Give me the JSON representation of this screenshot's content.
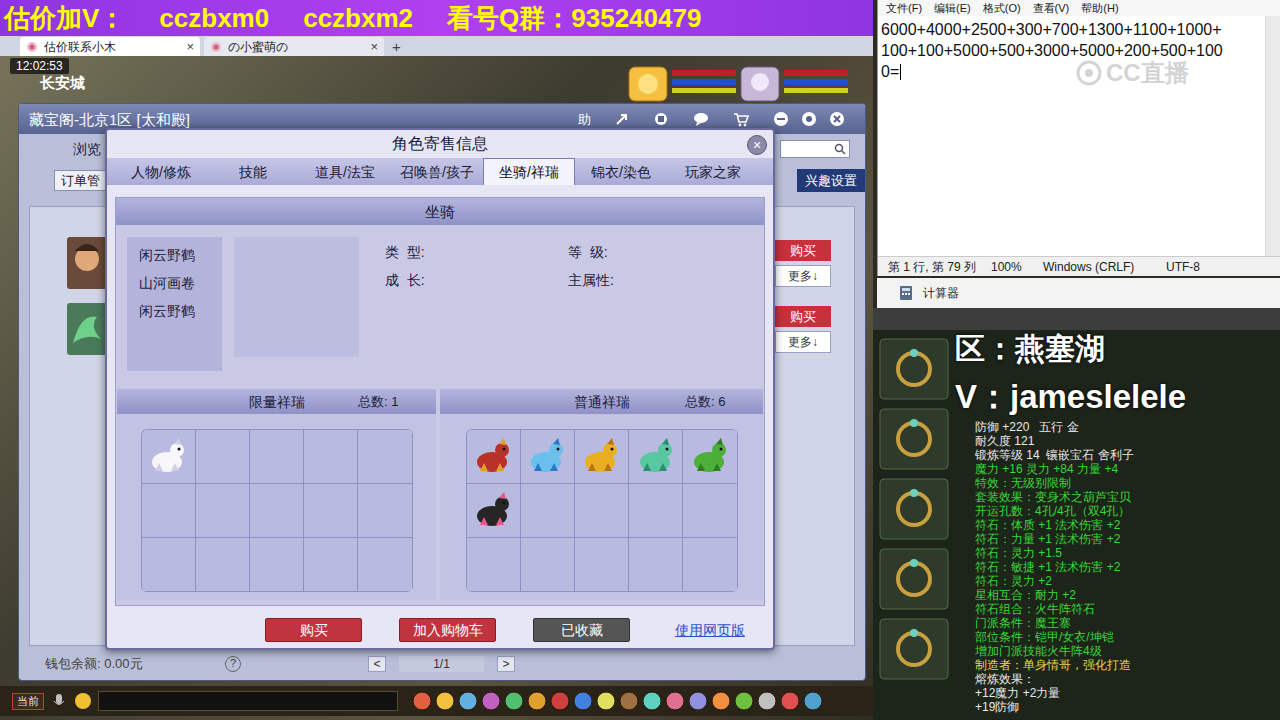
{
  "banner": [
    "估价加V：",
    "cczbxm0",
    "cczbxm2",
    "看号Q群：935240479"
  ],
  "browser": {
    "tabs": [
      {
        "label": "估价联系小木",
        "selected": true,
        "close": "×"
      },
      {
        "label": "の小蜜萌の",
        "selected": false,
        "close": "×"
      }
    ],
    "new_tab": "+"
  },
  "game": {
    "clock": "12:02:53",
    "location": "长安城",
    "chat_channel": "当前"
  },
  "cbg": {
    "title": "藏宝阁-北京1区 [太和殿]",
    "help": "助",
    "nav": "浏览",
    "orders": "订单管",
    "interest": "兴趣设置",
    "listings": [
      {
        "buy": "购买",
        "more": "更多↓"
      },
      {
        "buy": "购买",
        "more": "更多↓"
      }
    ],
    "wallet": "钱包余额: 0.00元",
    "help_mark": "?",
    "pager": {
      "prev": "<",
      "page": "1/1",
      "next": ">"
    }
  },
  "dialog": {
    "title": "角色寄售信息",
    "close": "×",
    "tabs": [
      {
        "label": "人物/修炼",
        "selected": false
      },
      {
        "label": "技能",
        "selected": false
      },
      {
        "label": "道具/法宝",
        "selected": false
      },
      {
        "label": "召唤兽/孩子",
        "selected": false
      },
      {
        "label": "坐骑/祥瑞",
        "selected": true
      },
      {
        "label": "锦衣/染色",
        "selected": false
      },
      {
        "label": "玩家之家",
        "selected": false
      }
    ],
    "section": "坐骑",
    "mounts": [
      {
        "name": "闲云野鹤",
        "selected": false
      },
      {
        "name": "山河画卷",
        "selected": false
      },
      {
        "name": "闲云野鹤",
        "selected": false
      }
    ],
    "fields": [
      "类  型:",
      "等  级:",
      "成  长:",
      "主属性:"
    ],
    "limited": {
      "title": "限量祥瑞",
      "total": "总数: 1",
      "slots": [
        {
          "filled": true
        },
        {
          "filled": false
        },
        {
          "filled": false
        },
        {
          "filled": false
        },
        {
          "filled": false
        },
        {
          "filled": false
        },
        {
          "filled": false
        },
        {
          "filled": false
        },
        {
          "filled": false
        },
        {
          "filled": false
        },
        {
          "filled": false
        },
        {
          "filled": false
        },
        {
          "filled": false
        },
        {
          "filled": false
        },
        {
          "filled": false
        }
      ]
    },
    "normal": {
      "title": "普通祥瑞",
      "total": "总数: 6",
      "slots": [
        {
          "filled": true
        },
        {
          "filled": true
        },
        {
          "filled": true
        },
        {
          "filled": true
        },
        {
          "filled": true
        },
        {
          "filled": true
        },
        {
          "filled": false
        },
        {
          "filled": false
        },
        {
          "filled": false
        },
        {
          "filled": false
        },
        {
          "filled": false
        },
        {
          "filled": false
        },
        {
          "filled": false
        },
        {
          "filled": false
        },
        {
          "filled": false
        }
      ]
    },
    "buttons": [
      {
        "label": "购买",
        "kind": "red"
      },
      {
        "label": "加入购物车",
        "kind": "red"
      },
      {
        "label": "已收藏",
        "kind": "gray"
      }
    ],
    "web_link": "使用网页版"
  },
  "notepad": {
    "menu": [
      "文件(F)",
      "编辑(E)",
      "格式(O)",
      "查看(V)",
      "帮助(H)"
    ],
    "lines": [
      "6000+4000+2500+300+700+1300+1100+1000+",
      "100+100+5000+500+3000+5000+200+500+100",
      "0="
    ],
    "status": [
      "第 1 行, 第 79 列",
      "100%",
      "Windows (CRLF)",
      "UTF-8"
    ]
  },
  "watermark": "CC直播",
  "calculator": {
    "title": "计算器"
  },
  "stream_overlay": {
    "region": "区：燕塞湖",
    "contact": "V：jameslelele"
  },
  "item_tooltip": {
    "lines": [
      {
        "text": "防御 +220   五行 金",
        "color": "#e8e8e8"
      },
      {
        "text": "耐久度 121",
        "color": "#e8e8e8"
      },
      {
        "text": "锻炼等级 14  镶嵌宝石 舍利子",
        "color": "#e8e8e8"
      },
      {
        "text": "魔力 +16 灵力 +84 力量 +4",
        "color": "#38d838"
      },
      {
        "text": "特效：无级别限制",
        "color": "#38d838"
      },
      {
        "text": "套装效果：变身术之葫芦宝贝",
        "color": "#38d838"
      },
      {
        "text": "开运孔数：4孔/4孔（双4孔）",
        "color": "#38d838"
      },
      {
        "text": "符石：体质 +1 法术伤害 +2",
        "color": "#38d838"
      },
      {
        "text": "符石：力量 +1 法术伤害 +2",
        "color": "#38d838"
      },
      {
        "text": "符石：灵力 +1.5",
        "color": "#38d838"
      },
      {
        "text": "符石：敏捷 +1 法术伤害 +2",
        "color": "#38d838"
      },
      {
        "text": "符石：灵力 +2",
        "color": "#38d838"
      },
      {
        "text": "星相互合：耐力 +2",
        "color": "#38d838"
      },
      {
        "text": "符石组合：火牛阵符石",
        "color": "#38d838"
      },
      {
        "text": "门派条件：魔王寨",
        "color": "#38d838"
      },
      {
        "text": "部位条件：铠甲/女衣/坤铠",
        "color": "#38d838"
      },
      {
        "text": "增加门派技能火牛阵4级",
        "color": "#38d838"
      },
      {
        "text": "制造者：单身情哥，强化打造",
        "color": "#e8d84a"
      },
      {
        "text": "熔炼效果：",
        "color": "#e8e8e8"
      },
      {
        "text": "+12魔力 +2力量",
        "color": "#e8e8e8"
      },
      {
        "text": "+19防御",
        "color": "#e8e8e8"
      }
    ]
  }
}
